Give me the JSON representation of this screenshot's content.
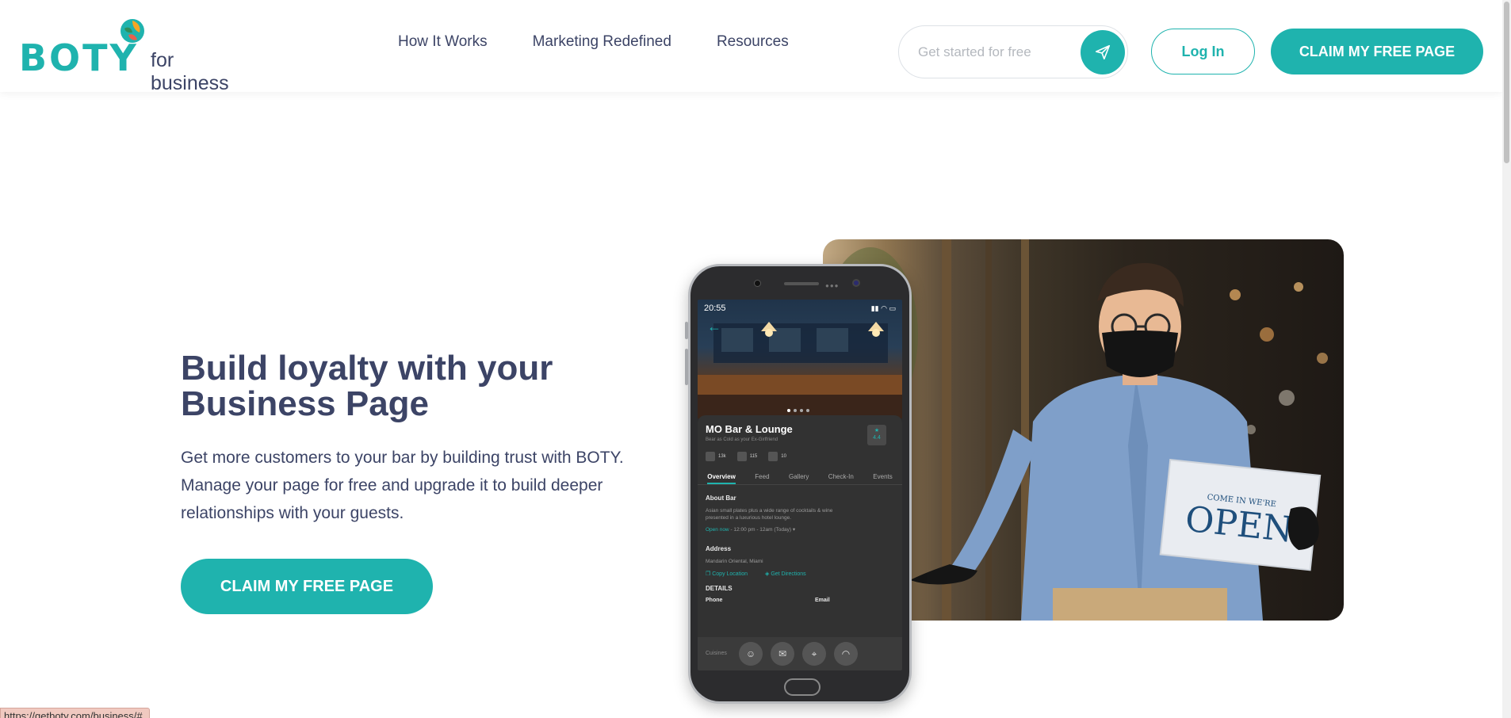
{
  "header": {
    "logo": {
      "word": "BOTY",
      "sub": "for business"
    },
    "nav": [
      {
        "label": "How It Works"
      },
      {
        "label": "Marketing Redefined"
      },
      {
        "label": "Resources"
      }
    ],
    "signup": {
      "placeholder": "Get started for free"
    },
    "login_label": "Log In",
    "claim_label": "CLAIM MY FREE PAGE"
  },
  "hero": {
    "title_line1": "Build loyalty with your",
    "title_line2": "Business Page",
    "desc_line1": "Get more customers to your bar by building trust with BOTY.",
    "desc_line2": "Manage your page for free and upgrade it to build deeper",
    "desc_line3": "relationships with your guests.",
    "cta_label": "CLAIM MY FREE PAGE"
  },
  "phone": {
    "time": "20:55",
    "business_name": "MO Bar & Lounge",
    "tagline": "Bear as Cold as your Ex-Girlfriend",
    "rating": "4.4",
    "stats": [
      "13k",
      "115",
      "10"
    ],
    "tabs": [
      "Overview",
      "Feed",
      "Gallery",
      "Check-In",
      "Events"
    ],
    "about_title": "About Bar",
    "about_text": "Asian small plates plus a wide range of cocktails & wine presented in a luxurious hotel lounge.",
    "open_now": "Open now",
    "hours": " - 12:00 pm - 12am (Today)",
    "address_title": "Address",
    "address": "Mandarin Oriental, Miami",
    "copy_location": "Copy Location",
    "get_directions": "Get Directions",
    "details_title": "DETAILS",
    "phone_label": "Phone",
    "email_label": "Email",
    "cuisines_label": "Cuisines"
  },
  "photo": {
    "sign_small": "COME IN WE'RE",
    "sign_big": "OPEN"
  },
  "status_url": "https://getboty.com/business/#",
  "colors": {
    "brand": "#1fb3ae",
    "text": "#3c4466"
  }
}
